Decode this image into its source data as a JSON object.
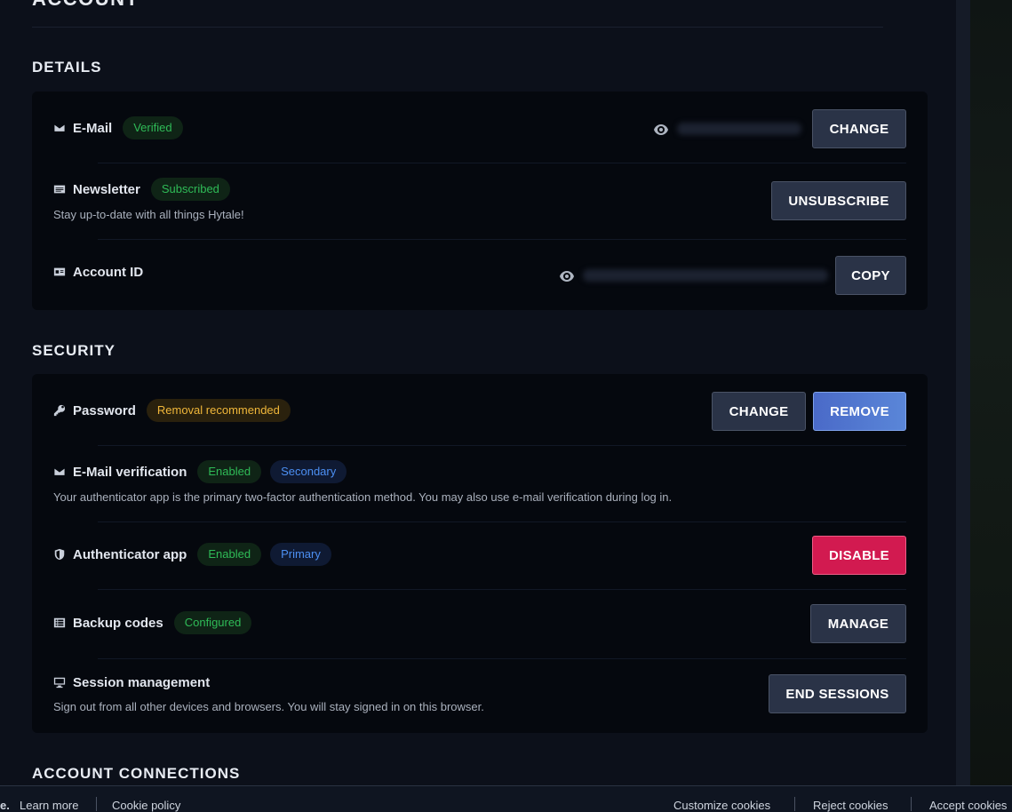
{
  "page_title": "ACCOUNT",
  "details": {
    "heading": "DETAILS",
    "email": {
      "label": "E-Mail",
      "badge": "Verified",
      "button": "CHANGE"
    },
    "newsletter": {
      "label": "Newsletter",
      "badge": "Subscribed",
      "description": "Stay up-to-date with all things Hytale!",
      "button": "UNSUBSCRIBE"
    },
    "account_id": {
      "label": "Account ID",
      "button": "COPY"
    }
  },
  "security": {
    "heading": "SECURITY",
    "password": {
      "label": "Password",
      "badge": "Removal recommended",
      "change_button": "CHANGE",
      "remove_button": "REMOVE"
    },
    "email_verification": {
      "label": "E-Mail verification",
      "badge_status": "Enabled",
      "badge_role": "Secondary",
      "description": "Your authenticator app is the primary two-factor authentication method. You may also use e-mail verification during log in."
    },
    "authenticator": {
      "label": "Authenticator app",
      "badge_status": "Enabled",
      "badge_role": "Primary",
      "button": "DISABLE"
    },
    "backup_codes": {
      "label": "Backup codes",
      "badge": "Configured",
      "button": "MANAGE"
    },
    "sessions": {
      "label": "Session management",
      "description": "Sign out from all other devices and browsers. You will stay signed in on this browser.",
      "button": "END SESSIONS"
    }
  },
  "connections": {
    "heading": "ACCOUNT CONNECTIONS"
  },
  "cookie_bar": {
    "fragment": "e.",
    "learn_more": "Learn more",
    "cookie_policy": "Cookie policy",
    "customize": "Customize cookies",
    "reject": "Reject cookies",
    "accept": "Accept cookies"
  },
  "colors": {
    "badge_green": "#2fbb57",
    "badge_blue": "#4c8ff2",
    "badge_amber": "#f0b73a",
    "danger": "#d21a50",
    "primary": "#4a6ac8"
  }
}
